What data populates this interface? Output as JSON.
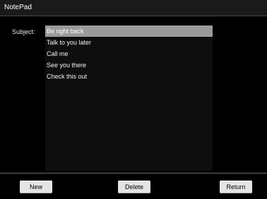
{
  "app": {
    "title": "NotePad"
  },
  "form": {
    "subject_label": "Subject:"
  },
  "list": {
    "items": [
      {
        "label": "Be right back",
        "selected": true
      },
      {
        "label": "Talk to you later",
        "selected": false
      },
      {
        "label": "Call me",
        "selected": false
      },
      {
        "label": "See you  there",
        "selected": false
      },
      {
        "label": "Check this out",
        "selected": false
      }
    ]
  },
  "buttons": {
    "new_label": "New",
    "delete_label": "Delete",
    "return_label": "Return"
  },
  "colors": {
    "background": "#000000",
    "selection": "#9a9a9a",
    "button_face": "#e4e4e4"
  }
}
